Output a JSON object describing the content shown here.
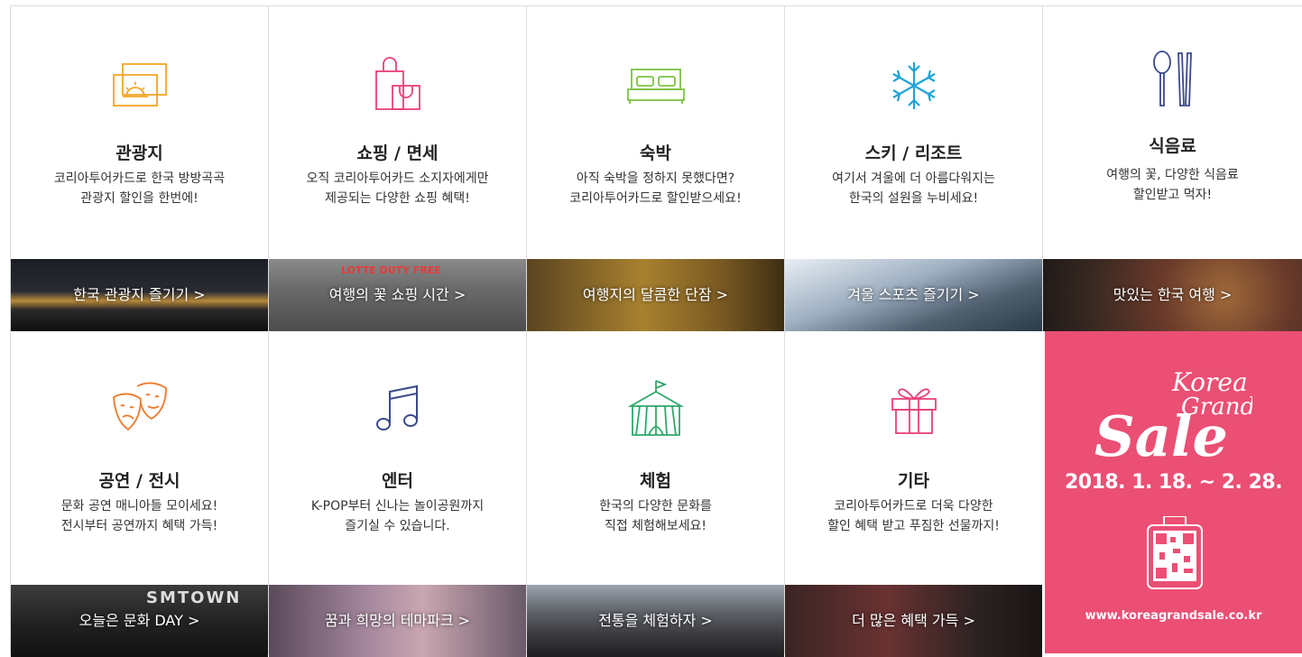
{
  "categories": [
    {
      "title": "관광지",
      "desc1": "코리아투어카드로 한국 방방곡곡",
      "desc2": "관광지 할인을 한번에!",
      "banner": "한국 관광지 즐기기 >",
      "icon": "sightseeing-icon"
    },
    {
      "title": "쇼핑 / 면세",
      "desc1": "오직 코리아투어카드 소지자에게만",
      "desc2": "제공되는 다양한 쇼핑 혜택!",
      "banner": "여행의 꽃 쇼핑 시간 >",
      "icon": "shopping-bag-icon",
      "banner_sign": "LOTTE DUTY FREE"
    },
    {
      "title": "숙박",
      "desc1": "아직 숙박을 정하지 못했다면?",
      "desc2": "코리아투어카드로 할인받으세요!",
      "banner": "여행지의 달콤한 단잠 >",
      "icon": "bed-icon"
    },
    {
      "title": "스키 / 리조트",
      "desc1": "여기서 겨울에 더 아름다워지는",
      "desc2": "한국의 설원을 누비세요!",
      "banner": "겨울 스포츠 즐기기 >",
      "icon": "snowflake-icon"
    },
    {
      "title": "식음료",
      "desc1": "여행의 꽃, 다양한 식음료",
      "desc2": "할인받고 먹자!",
      "banner": "맛있는 한국 여행 >",
      "icon": "spoon-chopsticks-icon"
    },
    {
      "title": "공연 / 전시",
      "desc1": "문화 공연 매니아들 모이세요!",
      "desc2": "전시부터 공연까지 혜택 가득!",
      "banner": "오늘은 문화 DAY >",
      "icon": "theater-masks-icon",
      "banner_sign": "SMTOWN"
    },
    {
      "title": "엔터",
      "desc1": "K-POP부터 신나는 놀이공원까지",
      "desc2": "즐기실 수 있습니다.",
      "banner": "꿈과 희망의 테마파크 >",
      "icon": "music-note-icon"
    },
    {
      "title": "체험",
      "desc1": "한국의 다양한 문화를",
      "desc2": "직접 체험해보세요!",
      "banner": "전통을 체험하자 >",
      "icon": "circus-tent-icon"
    },
    {
      "title": "기타",
      "desc1": "코리아투어카드로 더욱 다양한",
      "desc2": "할인 혜택 받고 푸짐한 선물까지!",
      "banner": "더 많은 혜택 가득 >",
      "icon": "gift-icon"
    }
  ],
  "promo": {
    "logo_line1": "Korea",
    "logo_line2": "Grand",
    "logo_line3": "Sale",
    "dates": "2018. 1. 18. ~ 2. 28.",
    "url": "www.koreagrandsale.co.kr"
  },
  "colors": {
    "orange": "#f5a623",
    "pink": "#e8407a",
    "green": "#7dc243",
    "teal": "#1ea3d8",
    "navy": "#3b4a8a",
    "promo_bg": "#eb4f74"
  }
}
